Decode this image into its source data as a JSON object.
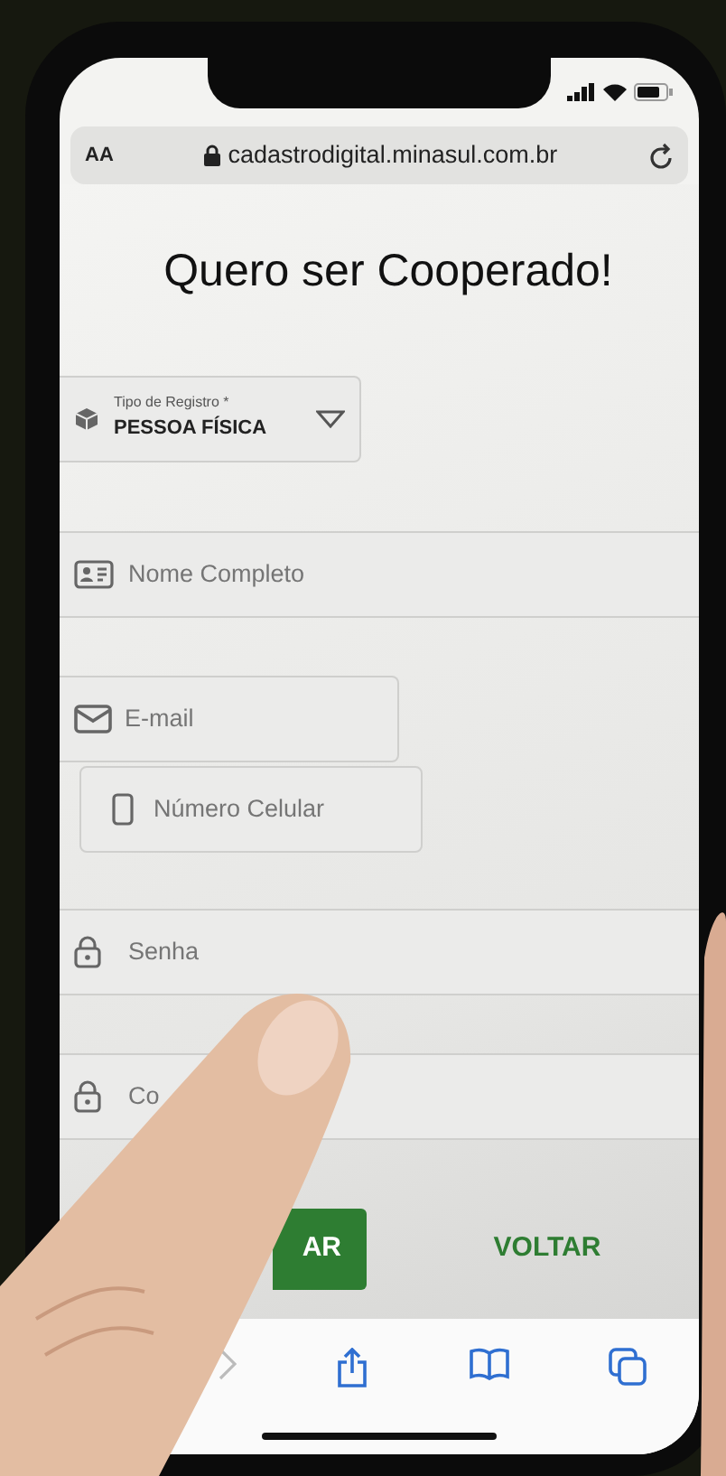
{
  "browser": {
    "text_size": "AA",
    "url": "cadastrodigital.minasul.com.br"
  },
  "title": "Quero ser Cooperado!",
  "register_type": {
    "label": "Tipo de Registro *",
    "value": "PESSOA FÍSICA"
  },
  "fields": [
    {
      "kind": "name",
      "placeholder": "Nome Completo"
    },
    {
      "kind": "email",
      "placeholder": "E-mail"
    },
    {
      "kind": "phone",
      "placeholder": "Número Celular"
    },
    {
      "kind": "password",
      "placeholder": "Senha"
    },
    {
      "kind": "password",
      "placeholder": "Co"
    }
  ],
  "buttons": [
    {
      "kind": "primary",
      "label": "AR"
    },
    {
      "kind": "link",
      "label": "VOLTAR"
    }
  ]
}
